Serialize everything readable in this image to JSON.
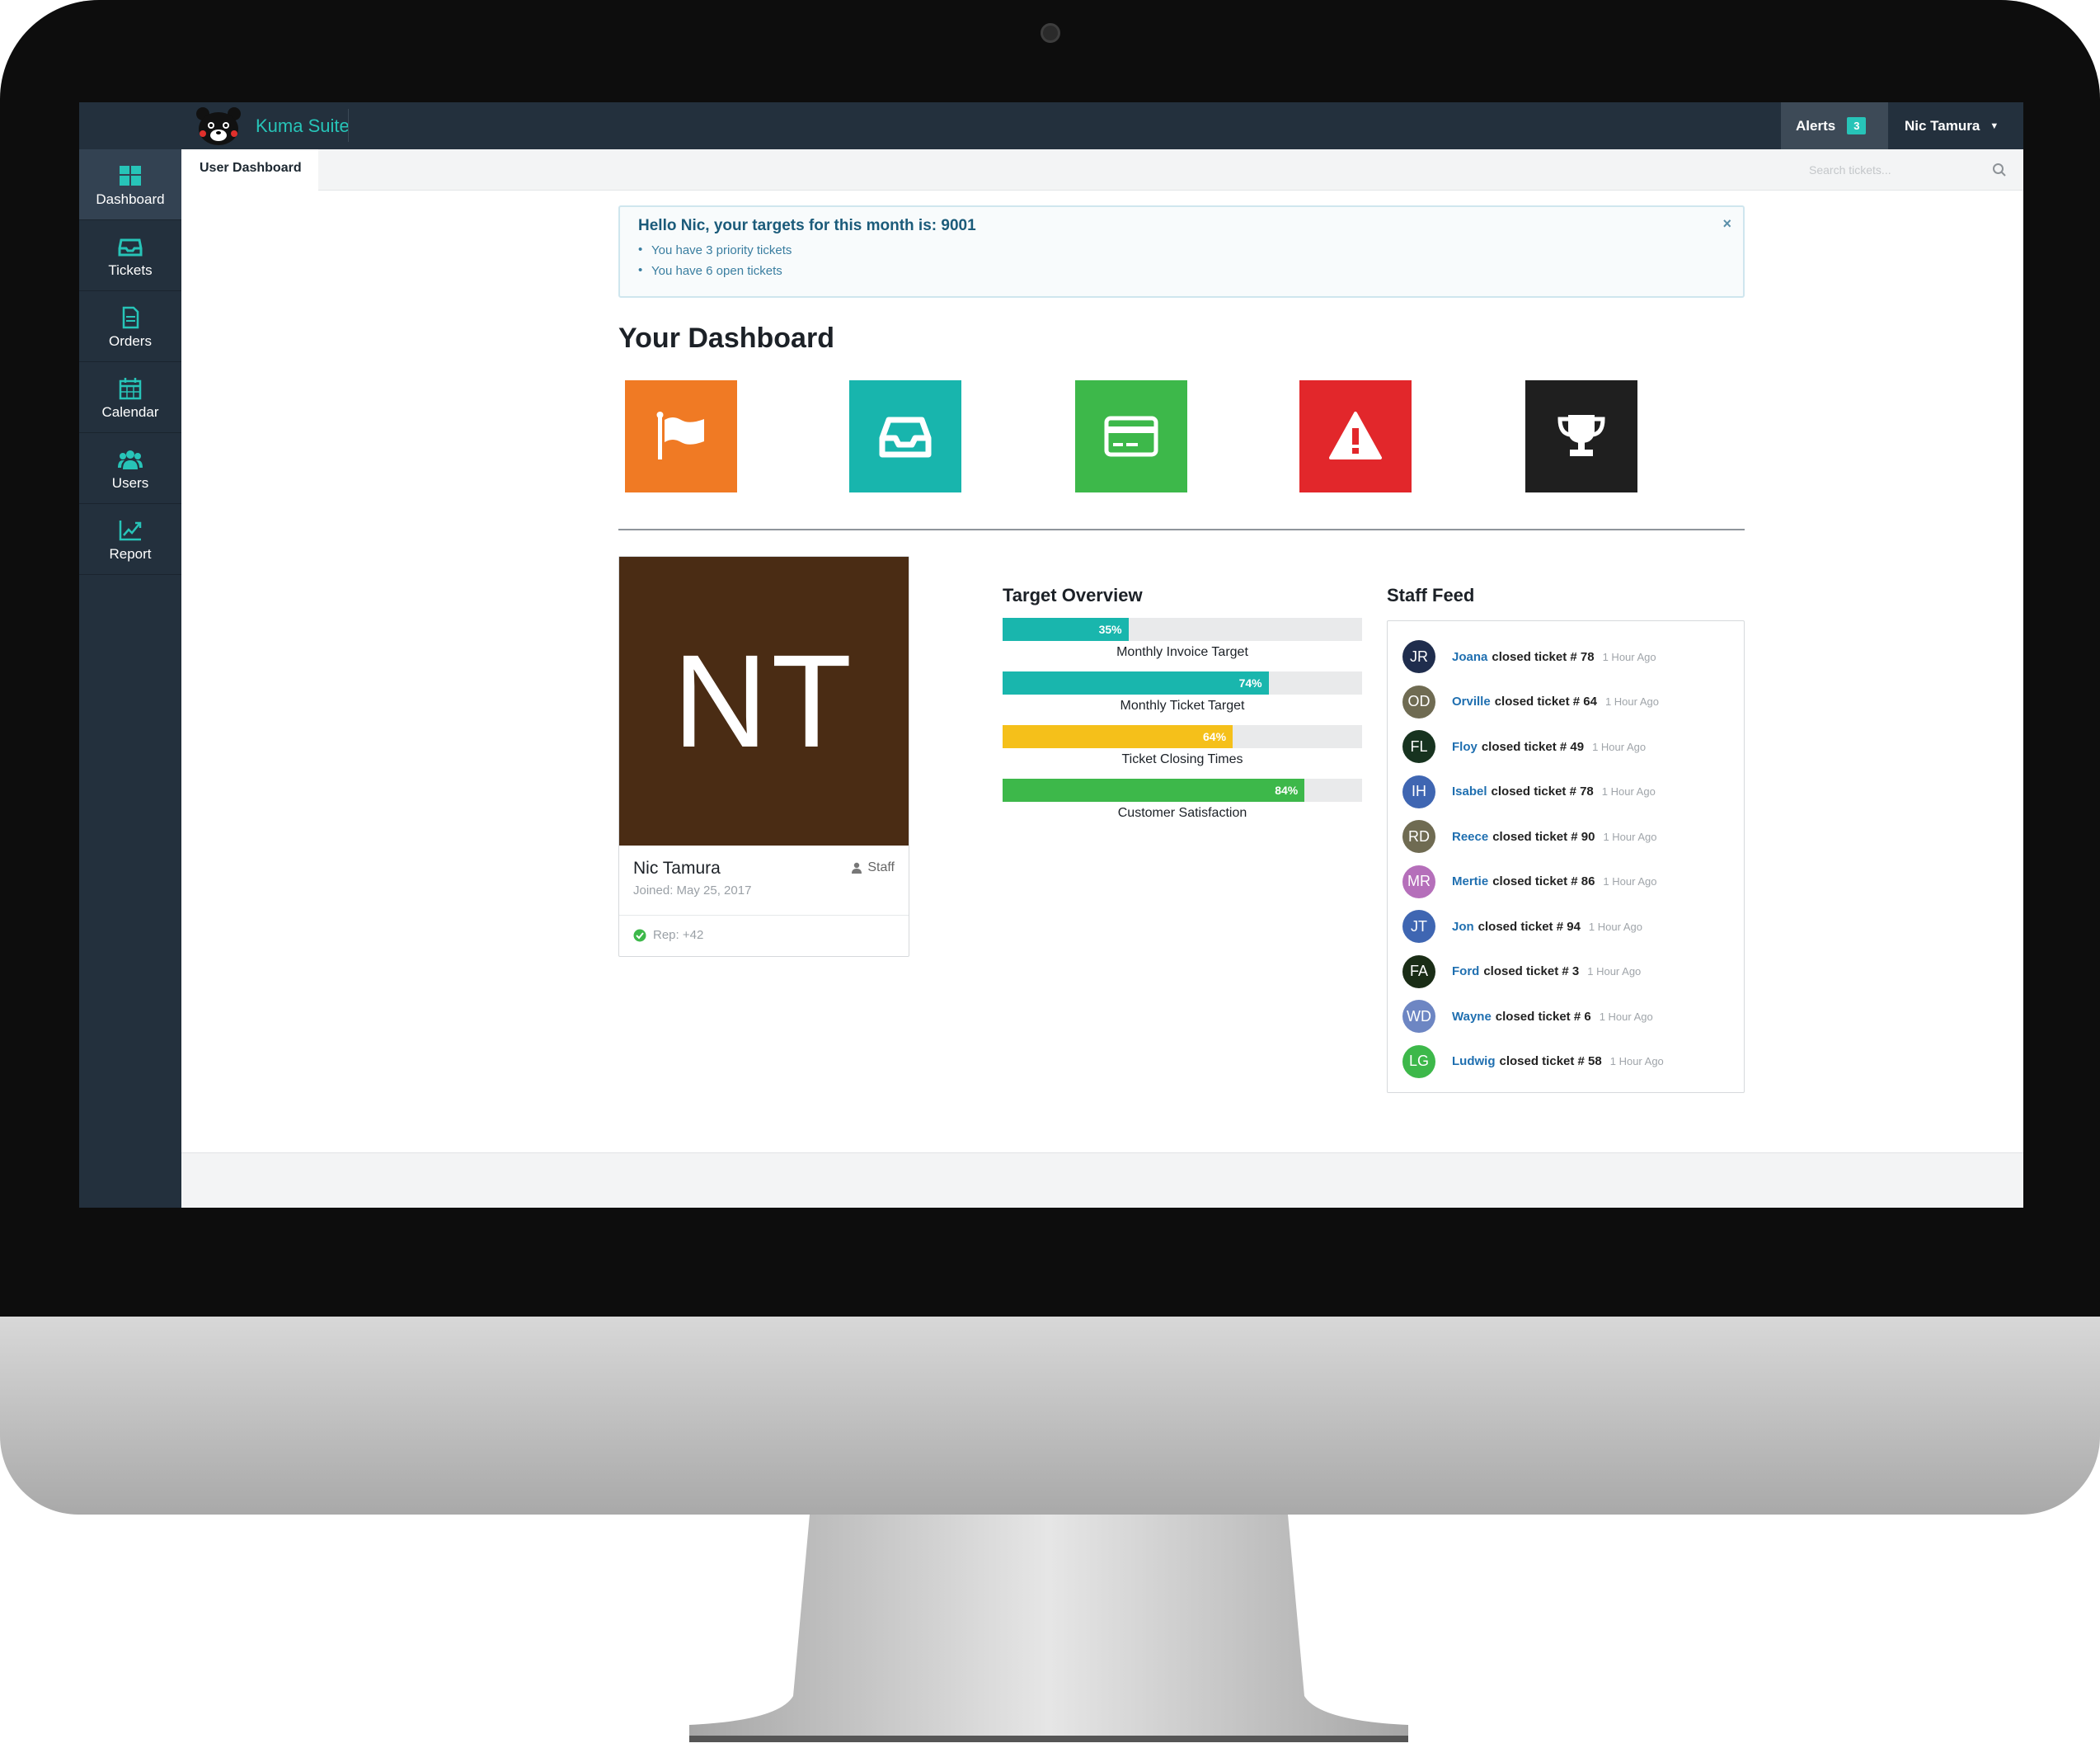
{
  "app": {
    "brand_name": "Kuma Suite",
    "alerts_label": "Alerts",
    "alerts_count": "3",
    "user_name": "Nic Tamura"
  },
  "sidebar": {
    "items": [
      {
        "label": "Dashboard",
        "icon": "dashboard-icon",
        "active": true
      },
      {
        "label": "Tickets",
        "icon": "inbox-icon",
        "active": false
      },
      {
        "label": "Orders",
        "icon": "document-icon",
        "active": false
      },
      {
        "label": "Calendar",
        "icon": "calendar-icon",
        "active": false
      },
      {
        "label": "Users",
        "icon": "users-icon",
        "active": false
      },
      {
        "label": "Report",
        "icon": "chart-line-icon",
        "active": false
      }
    ]
  },
  "tabs": {
    "active_label": "User Dashboard"
  },
  "search": {
    "placeholder": "Search tickets..."
  },
  "notice": {
    "title": "Hello Nic, your targets for this month is: 9001",
    "items": [
      "You have 3 priority tickets",
      "You have 6 open tickets"
    ],
    "close": "×"
  },
  "dashboard": {
    "title": "Your Dashboard",
    "tiles": [
      {
        "icon": "flag-icon",
        "color": "#f07a24"
      },
      {
        "icon": "inbox-icon",
        "color": "#18b5ad"
      },
      {
        "icon": "credit-card-icon",
        "color": "#3db84a"
      },
      {
        "icon": "warning-icon",
        "color": "#e2272b"
      },
      {
        "icon": "trophy-icon",
        "color": "#1f1f1f"
      }
    ]
  },
  "profile": {
    "initials": "NT",
    "avatar_color": "#4a2c14",
    "name": "Nic Tamura",
    "role": "Staff",
    "joined": "Joined: May 25, 2017",
    "rep": "Rep: +42"
  },
  "target_overview": {
    "title": "Target Overview",
    "bars": [
      {
        "label": "Monthly Invoice Target",
        "percent": 35,
        "percent_text": "35%",
        "color": "#19b6ad"
      },
      {
        "label": "Monthly Ticket Target",
        "percent": 74,
        "percent_text": "74%",
        "color": "#19b6ad"
      },
      {
        "label": "Ticket Closing Times",
        "percent": 64,
        "percent_text": "64%",
        "color": "#f5c01a"
      },
      {
        "label": "Customer Satisfaction",
        "percent": 84,
        "percent_text": "84%",
        "color": "#3db84a"
      }
    ]
  },
  "staff_feed": {
    "title": "Staff Feed",
    "items": [
      {
        "initials": "JR",
        "color": "#1f2d4d",
        "name": "Joana",
        "text": "closed ticket # 78",
        "time": "1 Hour Ago"
      },
      {
        "initials": "OD",
        "color": "#6f6b52",
        "name": "Orville",
        "text": "closed ticket # 64",
        "time": "1 Hour Ago"
      },
      {
        "initials": "FL",
        "color": "#17331f",
        "name": "Floy",
        "text": "closed ticket # 49",
        "time": "1 Hour Ago"
      },
      {
        "initials": "IH",
        "color": "#3f66b2",
        "name": "Isabel",
        "text": "closed ticket # 78",
        "time": "1 Hour Ago"
      },
      {
        "initials": "RD",
        "color": "#6f6b52",
        "name": "Reece",
        "text": "closed ticket # 90",
        "time": "1 Hour Ago"
      },
      {
        "initials": "MR",
        "color": "#b56fba",
        "name": "Mertie",
        "text": "closed ticket # 86",
        "time": "1 Hour Ago"
      },
      {
        "initials": "JT",
        "color": "#3f66b2",
        "name": "Jon",
        "text": "closed ticket # 94",
        "time": "1 Hour Ago"
      },
      {
        "initials": "FA",
        "color": "#1a2d16",
        "name": "Ford",
        "text": "closed ticket # 3",
        "time": "1 Hour Ago"
      },
      {
        "initials": "WD",
        "color": "#6d86c3",
        "name": "Wayne",
        "text": "closed ticket # 6",
        "time": "1 Hour Ago"
      },
      {
        "initials": "LG",
        "color": "#3db84a",
        "name": "Ludwig",
        "text": "closed ticket # 58",
        "time": "1 Hour Ago"
      }
    ]
  }
}
